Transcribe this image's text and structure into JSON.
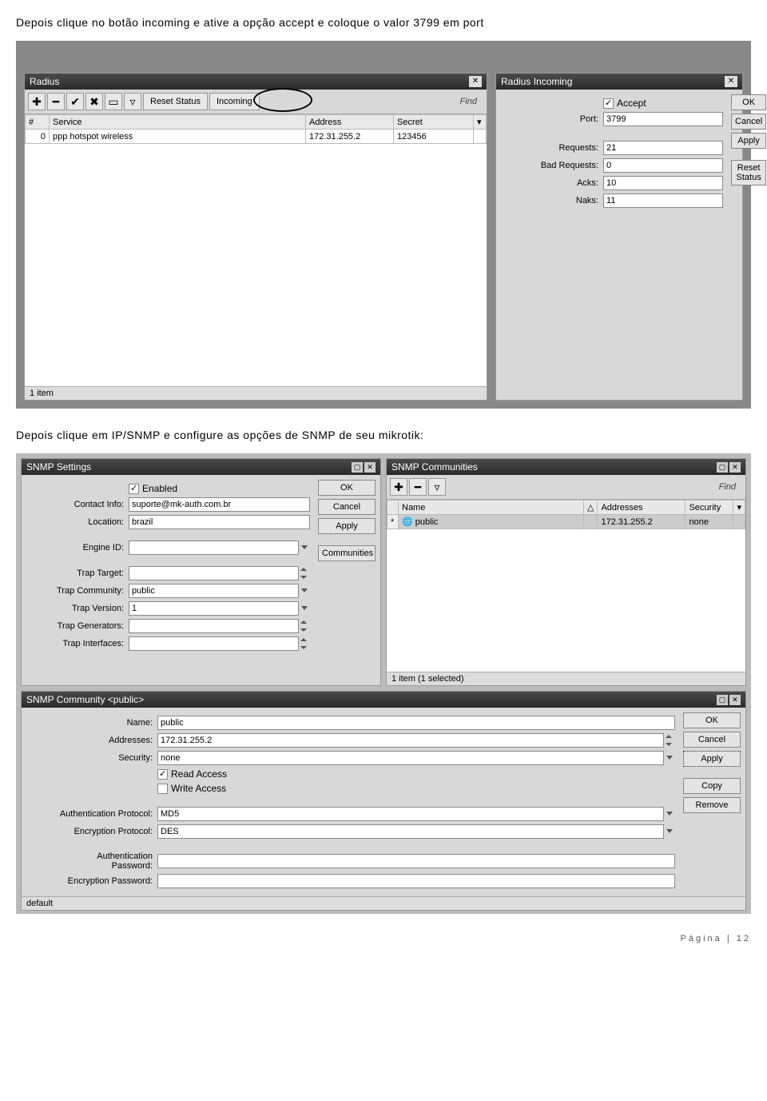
{
  "text1": "Depois clique no botão incoming e ative a opção accept e coloque o valor 3799 em port",
  "text2": "Depois clique em IP/SNMP e configure as opções de SNMP de seu mikrotik:",
  "radius": {
    "title": "Radius",
    "buttons": {
      "resetStatus": "Reset Status",
      "incoming": "Incoming",
      "find": "Find"
    },
    "cols": {
      "num": "#",
      "service": "Service",
      "address": "Address",
      "secret": "Secret"
    },
    "row": {
      "num": "0",
      "service": "ppp hotspot wireless",
      "address": "172.31.255.2",
      "secret": "123456"
    },
    "status": "1 item"
  },
  "incoming": {
    "title": "Radius Incoming",
    "acceptLabel": "Accept",
    "portLabel": "Port:",
    "port": "3799",
    "requestsLabel": "Requests:",
    "requests": "21",
    "badRequestsLabel": "Bad Requests:",
    "badRequests": "0",
    "acksLabel": "Acks:",
    "acks": "10",
    "naksLabel": "Naks:",
    "naks": "11",
    "btns": {
      "ok": "OK",
      "cancel": "Cancel",
      "apply": "Apply",
      "reset": "Reset Status"
    }
  },
  "snmpSettings": {
    "title": "SNMP Settings",
    "enabledLabel": "Enabled",
    "contactLabel": "Contact Info:",
    "contact": "suporte@mk-auth.com.br",
    "locationLabel": "Location:",
    "location": "brazil",
    "engineLabel": "Engine ID:",
    "engine": "",
    "trapTargetLabel": "Trap Target:",
    "trapTarget": "",
    "trapCommunityLabel": "Trap Community:",
    "trapCommunity": "public",
    "trapVersionLabel": "Trap Version:",
    "trapVersion": "1",
    "trapGenLabel": "Trap Generators:",
    "trapGen": "",
    "trapIfLabel": "Trap Interfaces:",
    "trapIf": "",
    "btns": {
      "ok": "OK",
      "cancel": "Cancel",
      "apply": "Apply",
      "communities": "Communities"
    }
  },
  "snmpComm": {
    "title": "SNMP Communities",
    "find": "Find",
    "cols": {
      "name": "Name",
      "addresses": "Addresses",
      "security": "Security"
    },
    "row": {
      "name": "public",
      "addresses": "172.31.255.2",
      "security": "none"
    },
    "status": "1 item (1 selected)"
  },
  "community": {
    "title": "SNMP Community <public>",
    "nameLabel": "Name:",
    "name": "public",
    "addrLabel": "Addresses:",
    "addr": "172.31.255.2",
    "secLabel": "Security:",
    "sec": "none",
    "readLabel": "Read Access",
    "writeLabel": "Write Access",
    "authProtoLabel": "Authentication Protocol:",
    "authProto": "MD5",
    "encProtoLabel": "Encryption Protocol:",
    "encProto": "DES",
    "authPassLabel": "Authentication Password:",
    "authPass": "",
    "encPassLabel": "Encryption Password:",
    "encPass": "",
    "status": "default",
    "btns": {
      "ok": "OK",
      "cancel": "Cancel",
      "apply": "Apply",
      "copy": "Copy",
      "remove": "Remove"
    }
  },
  "footer": {
    "pagina": "Página",
    "num": "12"
  }
}
